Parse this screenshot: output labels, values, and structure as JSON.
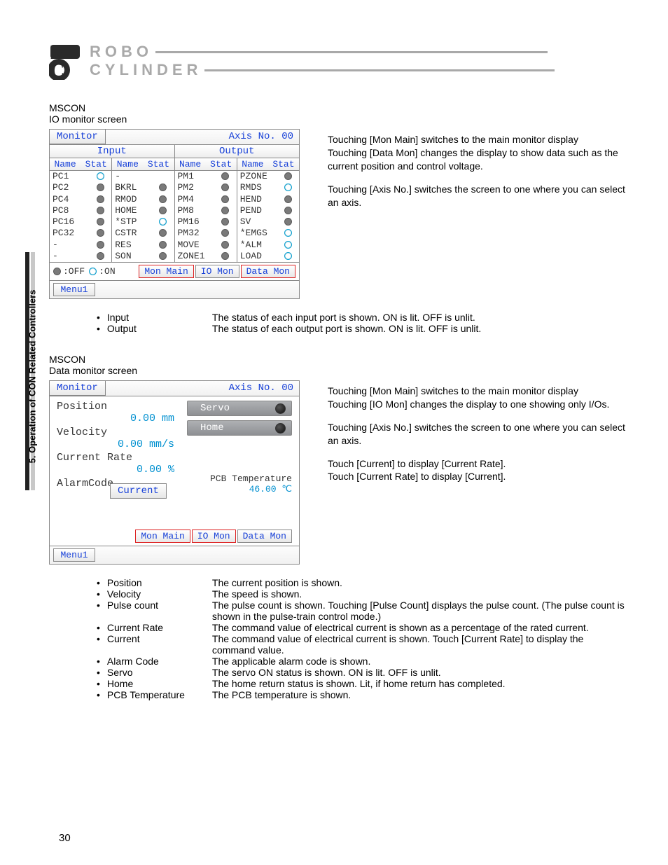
{
  "side_label": "5. Operation of CON Related Controllers",
  "logo": {
    "line1": "ROBO",
    "line2": "CYLINDER"
  },
  "page_number": "30",
  "sec1": {
    "title": "MSCON",
    "sub": "IO monitor screen",
    "desc": [
      "Touching [Mon Main] switches to the main monitor display",
      "Touching [Data Mon] changes the display to show data such as the current position and control voltage.",
      "Touching [Axis No.] switches the screen to one where you can select an axis."
    ],
    "bullets": [
      {
        "k": "Input",
        "v": "The status of each input port is shown. ON is lit. OFF is unlit."
      },
      {
        "k": "Output",
        "v": "The status of each output port is shown. ON is lit. OFF is unlit."
      }
    ]
  },
  "sec2": {
    "title": "MSCON",
    "sub": "Data monitor screen",
    "desc": [
      "Touching [Mon Main] switches to the main monitor display",
      "Touching [IO Mon] changes the display to one showing only I/Os.",
      "Touching [Axis No.] switches the screen to one where you can select an axis.",
      "Touch [Current] to display [Current Rate].\nTouch [Current Rate] to display [Current]."
    ],
    "fields": [
      {
        "k": "Position",
        "v": "The current position is shown."
      },
      {
        "k": "Velocity",
        "v": "The speed is shown."
      },
      {
        "k": "Pulse count",
        "v": "The pulse count is shown. Touching [Pulse Count] displays the pulse count. (The pulse count is shown in the pulse-train control mode.)"
      },
      {
        "k": "Current Rate",
        "v": "The command value of electrical current is shown as a percentage of the rated current."
      },
      {
        "k": "Current",
        "v": "The command value of electrical current is shown. Touch [Current Rate] to display the command value."
      },
      {
        "k": "Alarm Code",
        "v": "The applicable alarm code is shown."
      },
      {
        "k": "Servo",
        "v": "The servo ON status is shown. ON is lit. OFF is unlit."
      },
      {
        "k": "Home",
        "v": "The home return status is shown. Lit, if home return has completed."
      },
      {
        "k": "PCB Temperature",
        "v": "The PCB temperature is shown."
      }
    ]
  },
  "io_screen": {
    "title": "Monitor",
    "axis": "Axis No. 00",
    "input_title": "Input",
    "output_title": "Output",
    "name_hdr": "Name",
    "stat_hdr": "Stat",
    "in_left": [
      {
        "n": "PC1",
        "s": "on"
      },
      {
        "n": "PC2",
        "s": "off"
      },
      {
        "n": "PC4",
        "s": "off"
      },
      {
        "n": "PC8",
        "s": "off"
      },
      {
        "n": "PC16",
        "s": "off"
      },
      {
        "n": "PC32",
        "s": "off"
      },
      {
        "n": "-",
        "s": "off"
      },
      {
        "n": "-",
        "s": "off"
      }
    ],
    "in_right": [
      {
        "n": "-",
        "s": ""
      },
      {
        "n": "BKRL",
        "s": "off"
      },
      {
        "n": "RMOD",
        "s": "off"
      },
      {
        "n": "HOME",
        "s": "off"
      },
      {
        "n": "*STP",
        "s": "on"
      },
      {
        "n": "CSTR",
        "s": "off"
      },
      {
        "n": "RES",
        "s": "off"
      },
      {
        "n": "SON",
        "s": "off"
      }
    ],
    "out_left": [
      {
        "n": "PM1",
        "s": "off"
      },
      {
        "n": "PM2",
        "s": "off"
      },
      {
        "n": "PM4",
        "s": "off"
      },
      {
        "n": "PM8",
        "s": "off"
      },
      {
        "n": "PM16",
        "s": "off"
      },
      {
        "n": "PM32",
        "s": "off"
      },
      {
        "n": "MOVE",
        "s": "off"
      },
      {
        "n": "ZONE1",
        "s": "off"
      }
    ],
    "out_right": [
      {
        "n": "PZONE",
        "s": "off"
      },
      {
        "n": "RMDS",
        "s": "on"
      },
      {
        "n": "HEND",
        "s": "off"
      },
      {
        "n": "PEND",
        "s": "off"
      },
      {
        "n": "SV",
        "s": "off"
      },
      {
        "n": "*EMGS",
        "s": "on"
      },
      {
        "n": "*ALM",
        "s": "on"
      },
      {
        "n": "LOAD",
        "s": "on"
      }
    ],
    "legend_off": ":OFF",
    "legend_on": ":ON",
    "tabs": {
      "main": "Mon Main",
      "io": "IO Mon",
      "data": "Data Mon"
    },
    "menu": "Menu1"
  },
  "dm_screen": {
    "title": "Monitor",
    "axis": "Axis No. 00",
    "position_lbl": "Position",
    "position_val": "0.00 mm",
    "velocity_lbl": "Velocity",
    "velocity_val": "0.00 mm/s",
    "cr_lbl": "Current Rate",
    "cr_val": "0.00 %",
    "alarm_lbl": "AlarmCode",
    "servo": "Servo",
    "home": "Home",
    "current_btn": "Current",
    "temp_lbl": "PCB Temperature",
    "temp_val": "46.00 ℃",
    "tabs": {
      "main": "Mon Main",
      "io": "IO Mon",
      "data": "Data Mon"
    },
    "menu": "Menu1"
  }
}
